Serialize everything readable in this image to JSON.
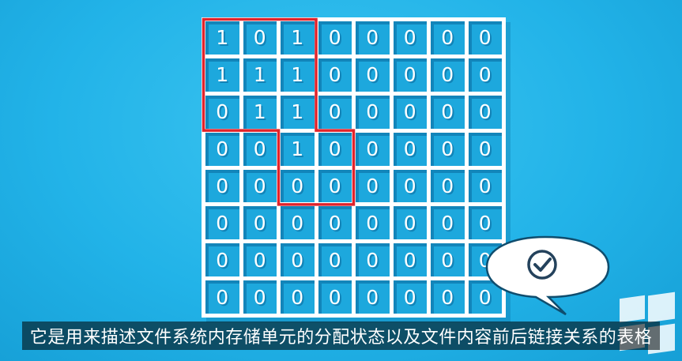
{
  "grid": {
    "rows": [
      [
        "1",
        "0",
        "1",
        "0",
        "0",
        "0",
        "0",
        "0"
      ],
      [
        "1",
        "1",
        "1",
        "0",
        "0",
        "0",
        "0",
        "0"
      ],
      [
        "0",
        "1",
        "1",
        "0",
        "0",
        "0",
        "0",
        "0"
      ],
      [
        "0",
        "0",
        "1",
        "0",
        "0",
        "0",
        "0",
        "0"
      ],
      [
        "0",
        "0",
        "0",
        "0",
        "0",
        "0",
        "0",
        "0"
      ],
      [
        "0",
        "0",
        "0",
        "0",
        "0",
        "0",
        "0",
        "0"
      ],
      [
        "0",
        "0",
        "0",
        "0",
        "0",
        "0",
        "0",
        "0"
      ],
      [
        "0",
        "0",
        "0",
        "0",
        "0",
        "0",
        "0",
        "0"
      ]
    ],
    "highlight_color": "#e0232b",
    "cell_color": "#1da8dd",
    "background_color": "#22b3e8"
  },
  "speech_bubble": {
    "icon": "checkmark-circle-icon"
  },
  "logo": {
    "icon": "windows-logo-icon"
  },
  "subtitle": {
    "text": "它是用来描述文件系统内存储单元的分配状态以及文件内容前后链接关系的表格"
  }
}
